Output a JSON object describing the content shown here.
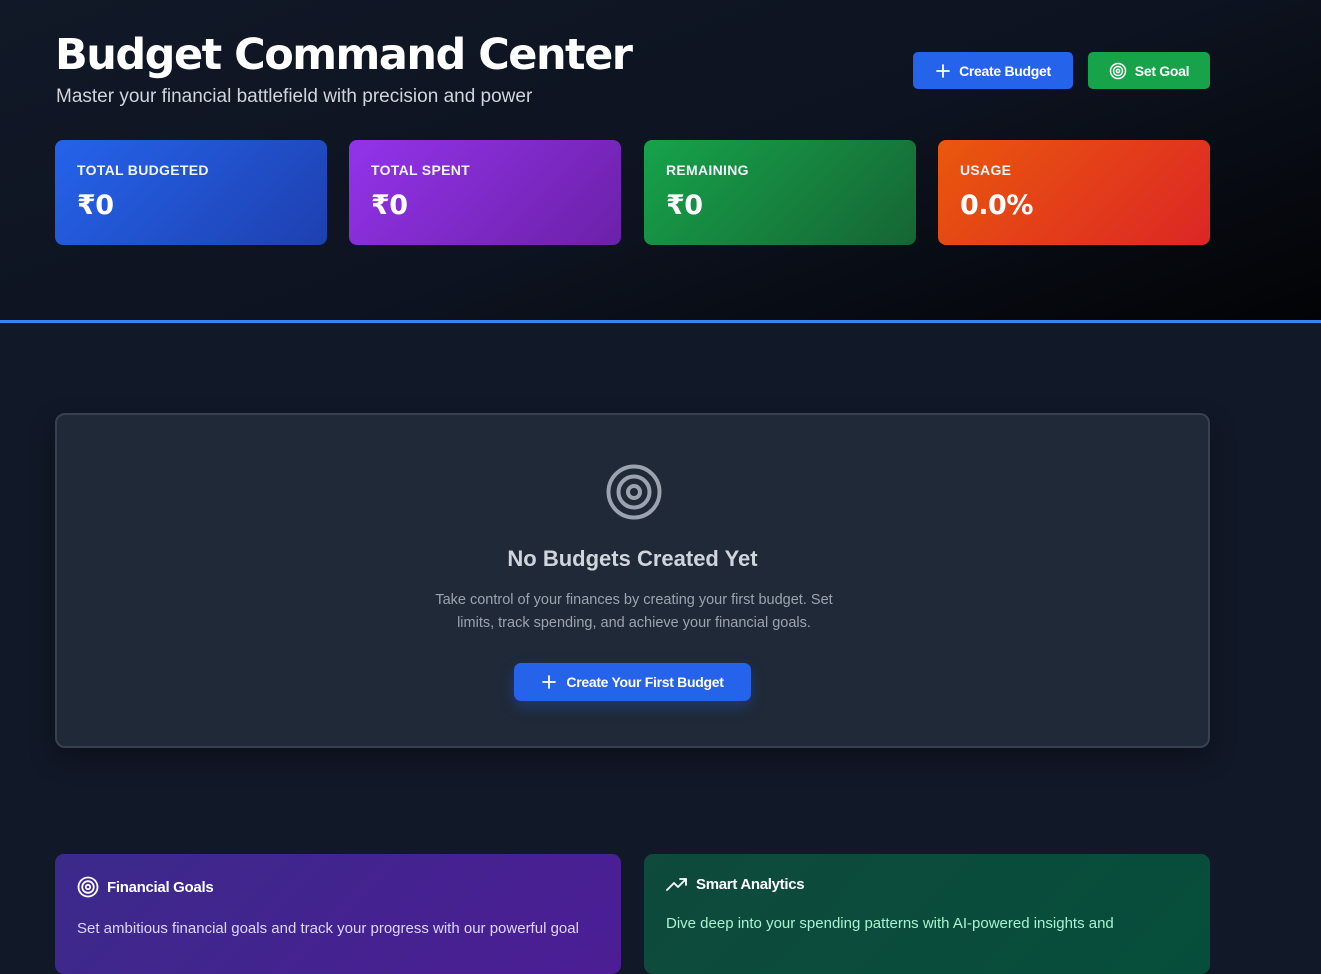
{
  "header": {
    "title": "Budget Command Center",
    "subtitle": "Master your financial battlefield with precision and power",
    "create_budget_label": "Create Budget",
    "set_goal_label": "Set Goal"
  },
  "stats": [
    {
      "label": "TOTAL BUDGETED",
      "value": "₹0",
      "color": "#2563eb"
    },
    {
      "label": "TOTAL SPENT",
      "value": "₹0",
      "color": "#9333ea"
    },
    {
      "label": "REMAINING",
      "value": "₹0",
      "color": "#16a34a"
    },
    {
      "label": "USAGE",
      "value": "0.0%",
      "color": "#ea580c"
    }
  ],
  "empty_state": {
    "icon": "target-icon",
    "title": "No Budgets Created Yet",
    "description": "Take control of your finances by creating your first budget. Set limits, track spending, and achieve your financial goals.",
    "button_label": "Create Your First Budget"
  },
  "features": [
    {
      "icon": "target-icon",
      "title": "Financial Goals",
      "description": "Set ambitious financial goals and track your progress with our powerful goal"
    },
    {
      "icon": "trending-up-icon",
      "title": "Smart Analytics",
      "description": "Dive deep into your spending patterns with AI-powered insights and"
    }
  ],
  "colors": {
    "accent_blue": "#2563eb",
    "accent_green": "#16a34a",
    "divider": "#3b82f6",
    "background": "#111827"
  }
}
